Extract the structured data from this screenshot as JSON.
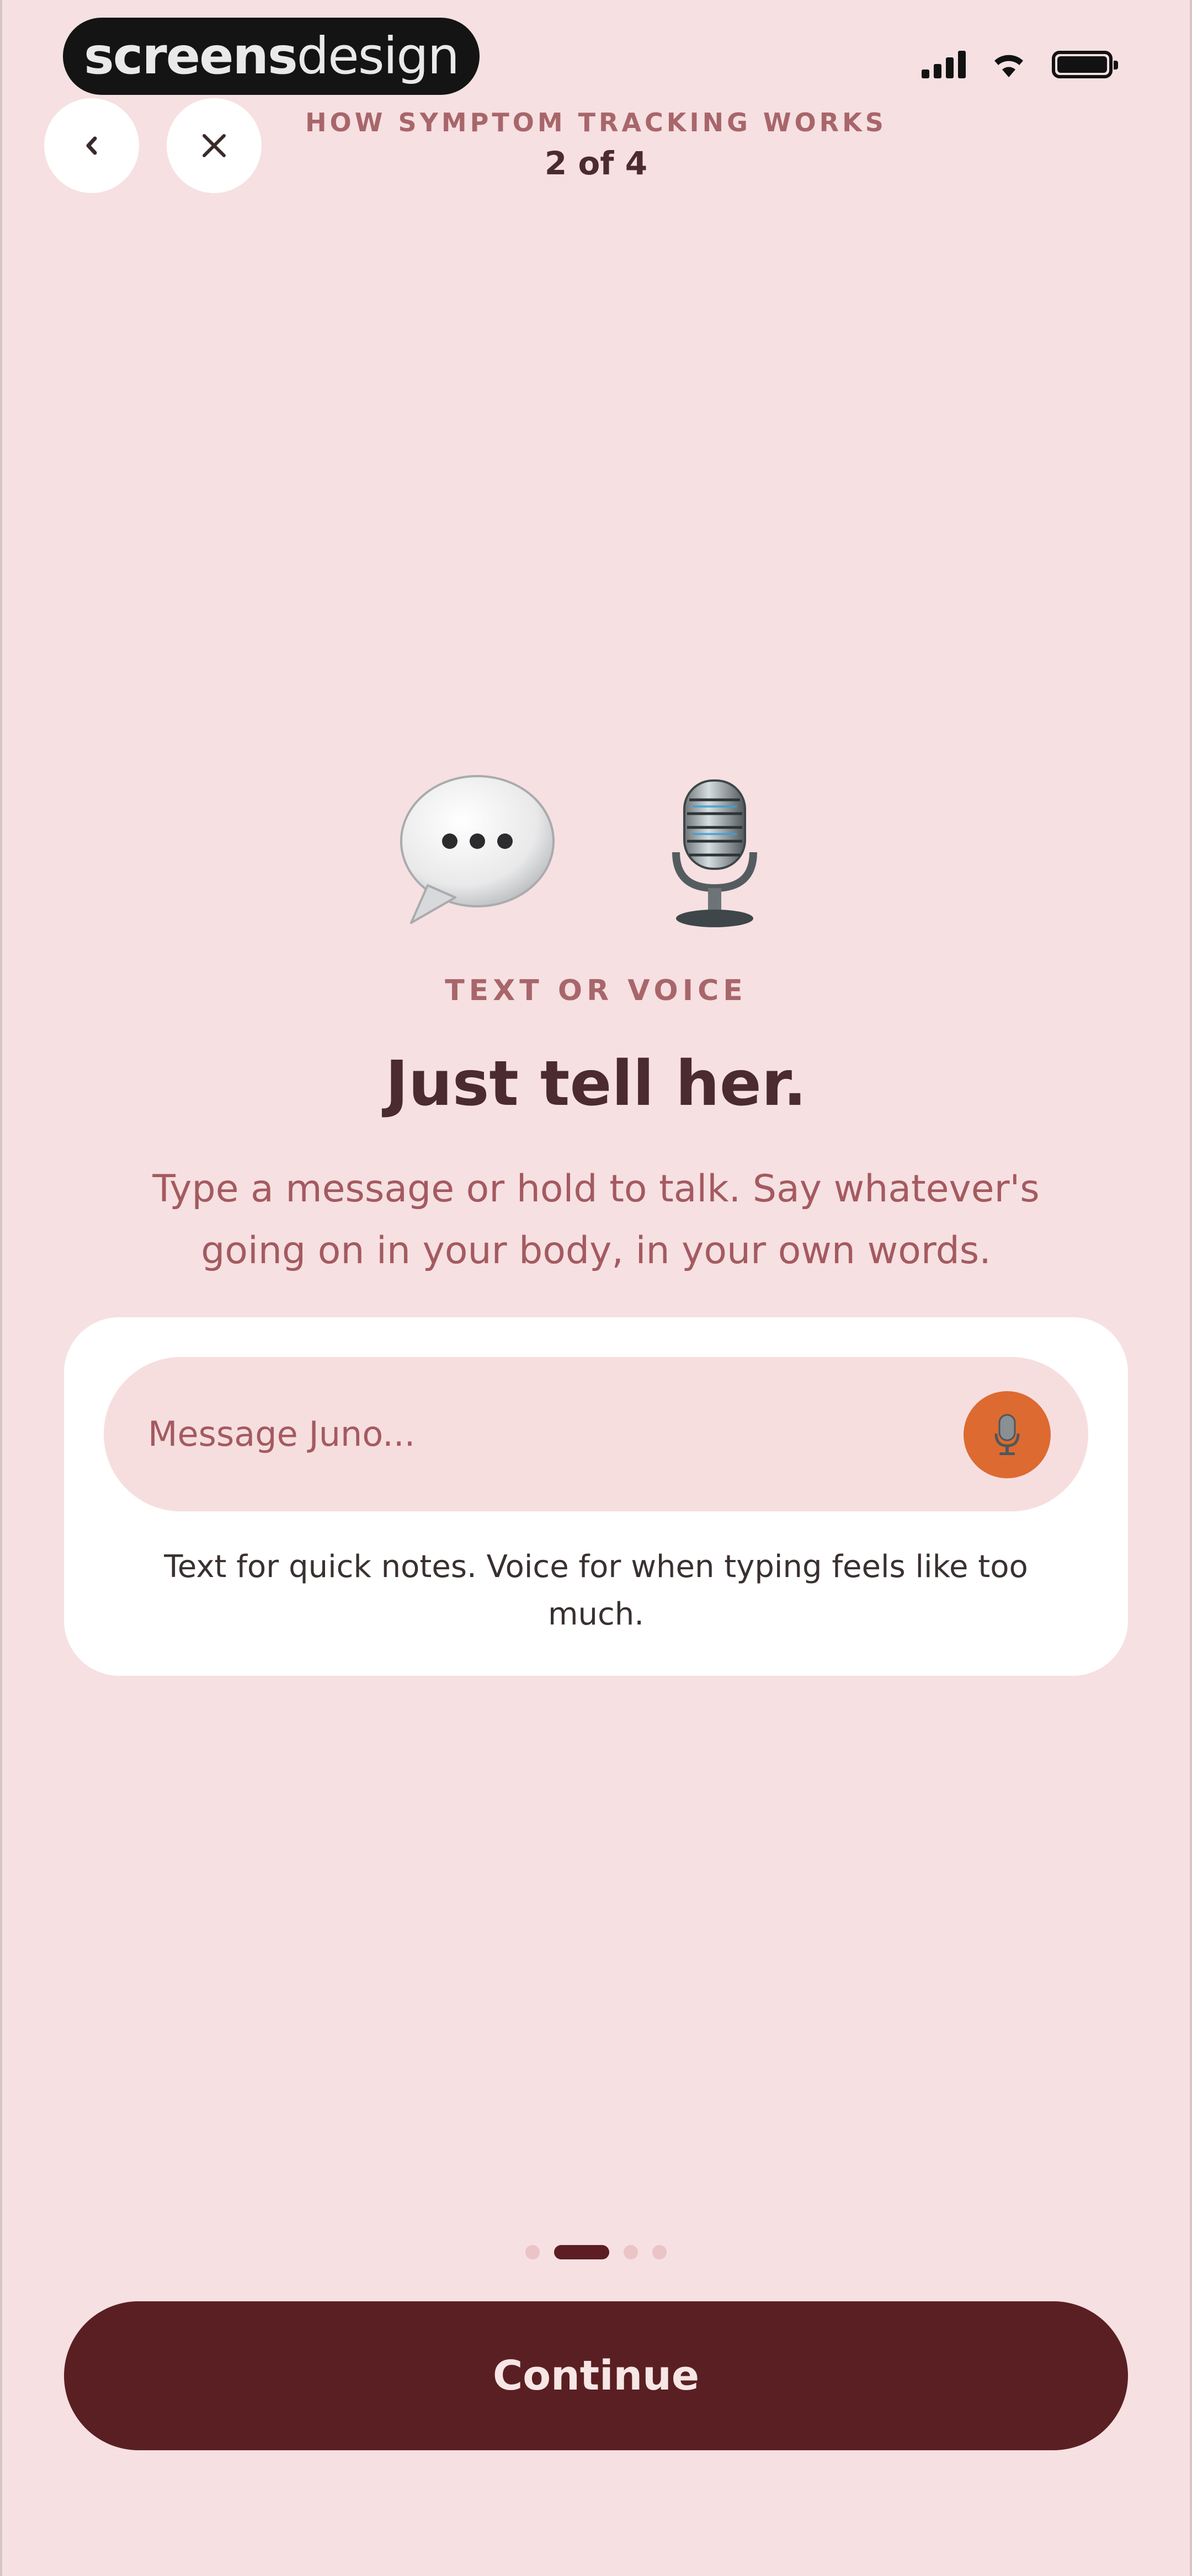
{
  "status_bar": {
    "brand_bold": "screens",
    "brand_light": "design"
  },
  "header": {
    "eyebrow": "HOW SYMPTOM TRACKING WORKS",
    "step_counter": "2 of 4"
  },
  "content": {
    "eyebrow": "TEXT OR VOICE",
    "headline": "Just tell her.",
    "body": "Type a message or hold to talk. Say whatever's going on in your body, in your own words."
  },
  "card": {
    "input_placeholder": "Message Juno...",
    "note": "Text for quick notes. Voice for when typing feels like too much."
  },
  "pagination": {
    "total_pages": 4,
    "current_page": 2
  },
  "footer": {
    "continue_label": "Continue"
  },
  "colors": {
    "background": "#f6e0e1",
    "accent_dark": "#5a1f22",
    "accent_text": "#a45a60",
    "mic_orange": "#dd6a31"
  },
  "icons": {
    "back": "chevron-left-icon",
    "close": "close-icon",
    "hero_left": "speech-bubble-icon",
    "hero_right": "studio-microphone-icon",
    "input_mic": "microphone-icon"
  }
}
